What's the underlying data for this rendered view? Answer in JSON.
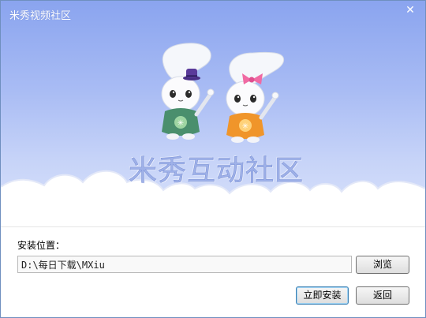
{
  "window": {
    "title": "米秀视频社区",
    "close_glyph": "✕"
  },
  "banner": {
    "brand_text": "米秀互动社区"
  },
  "install": {
    "label": "安装位置：",
    "path_value": "D:\\每日下载\\MXiu",
    "browse_label": "浏览",
    "install_label": "立即安装",
    "back_label": "返回"
  },
  "colors": {
    "banner_top": "#8aa4ef",
    "banner_bottom": "#dbe3fb",
    "mascot_left_body": "#4a8f6d",
    "mascot_right_body": "#f0952a",
    "hat_color": "#5a3a9a",
    "bow_color": "#f06aa3"
  }
}
